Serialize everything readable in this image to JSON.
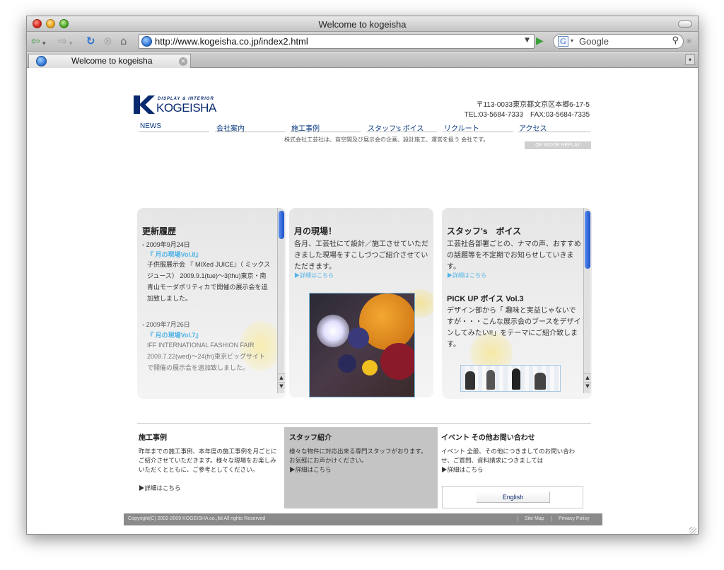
{
  "window": {
    "title": "Welcome to kogeisha"
  },
  "toolbar": {
    "url": "http://www.kogeisha.co.jp/index2.html",
    "search_placeholder": "Google"
  },
  "tab": {
    "label": "Welcome to kogeisha"
  },
  "site": {
    "logo_sub": "DISPLAY & INTERIOR",
    "logo_name": "KOGEISHA",
    "address": "〒113-0033東京都文京区本郷6-17-5",
    "tel": "TEL:03-5684-7333　FAX:03-5684-7335",
    "nav": [
      "NEWS",
      "会社案内",
      "施工事例",
      "スタッフ's ボイス",
      "リクルート",
      "アクセス"
    ],
    "tagline": "株式会社工芸社は、商空間及び展示会の企画、設計施工、運営を扱う 会社です。",
    "op_movie": "OP MOVIE REPLAY"
  },
  "panels": {
    "news": {
      "heading": "更新履歴",
      "item1_date": "2009年9月24日",
      "item1_link": "『 月の現場Vol.8』",
      "item1_text": "子供服展示会 『 MIXed JUICE』（ ミックスジュース） 2009.9.1(tue)〜3(thu)東京・南青山モーダポリティカで開催の展示会を追加致しました。",
      "item2_date": "2009年7月26日",
      "item2_link": "『 月の現場Vol.7』",
      "item2_text": "IFF INTERNATIONAL FASHION FAIR 2009.7.22(wed)〜24(fri)東京ビッグサイトで開催の展示会を追加致しました。"
    },
    "site_month": {
      "heading": "月の現場！",
      "text": "各月、工芸社にて設計／施工させていただきました現場をすこしづつご紹介させていただきます。",
      "link": "▶詳細はこちら"
    },
    "staff": {
      "heading": "スタッフ's　ボイス",
      "text": "工芸社各部署ごとの、ナマの声、おすすめの話題等を不定期でお知らせしていきます。",
      "link": "▶詳細はこちら",
      "pickup_heading": "PICK UP ボイス Vol.3",
      "pickup_text": "デザイン部から「 趣味と実益じゃないですが・・・こんな展示会のブースをデザインしてみたい!!」をテーマにご紹介致します。"
    }
  },
  "bottom": {
    "cases": {
      "heading": "施工事例",
      "text": "昨年までの施工事例、本年度の施工事例を月ごとにご紹介させていただきます。様々な現場をお楽しみいただくとともに、ご参考としてください。",
      "link": "▶詳細はこちら"
    },
    "staff_intro": {
      "heading": "スタッフ紹介",
      "text": "様々な物件に対応出来る専門スタッフがおります。お気軽にお声かけください。",
      "link": "▶詳細はこちら"
    },
    "events": {
      "heading": "イベント その他お問い合わせ",
      "text": "イベント 全般、その他につきましてのお問い合わせ、ご質問、資料請求につきましては",
      "link": "▶詳細はこちら",
      "english": "English"
    }
  },
  "footer": {
    "copyright": "Copyright(C) 2002-2009 KOGEISHA co.,ltd All rights Reserved",
    "sitemap": "Site Map",
    "privacy": "Privacy Policy"
  }
}
